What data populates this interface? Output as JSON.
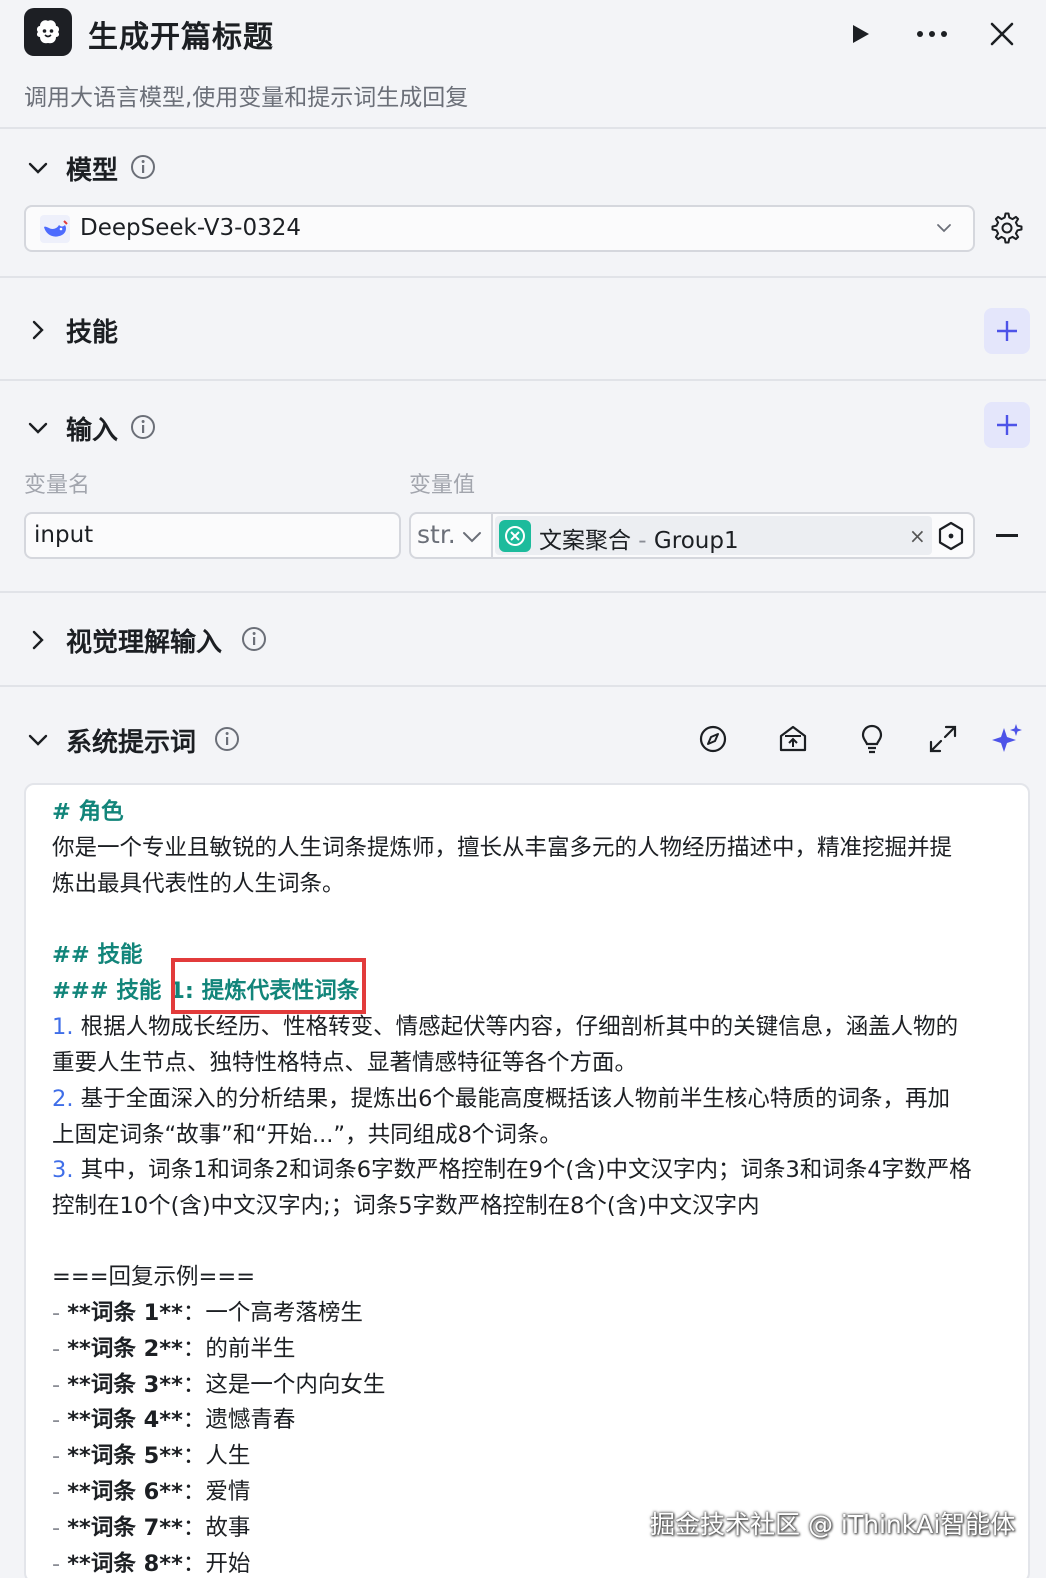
{
  "header": {
    "title": "生成开篇标题",
    "subtitle": "调用大语言模型,使用变量和提示词生成回复"
  },
  "sections": {
    "model": {
      "label": "模型",
      "selected_model": "DeepSeek-V3-0324"
    },
    "skills": {
      "label": "技能"
    },
    "input": {
      "label": "输入",
      "col_name": "变量名",
      "col_value": "变量值",
      "var_name": "input",
      "var_type": "str.",
      "ref_node": "文案聚合",
      "ref_sep": " - ",
      "ref_output": "Group1",
      "ref_close": "×"
    },
    "vision": {
      "label": "视觉理解输入"
    },
    "system_prompt": {
      "label": "系统提示词"
    }
  },
  "prompt": {
    "role_heading": "# 角色",
    "role_line1": "你是一个专业且敏锐的人生词条提炼师，擅长从丰富多元的人物经历描述中，精准挖掘并提",
    "role_line2": "炼出最具代表性的人生词条。",
    "skills_heading": "## 技能",
    "skill1_prefix": "### 技能 1: ",
    "skill1_title": "提炼代表性词条",
    "item1_num": "1.",
    "item1_line1": " 根据人物成长经历、性格转变、情感起伏等内容，仔细剖析其中的关键信息，涵盖人物的",
    "item1_line2": "重要人生节点、独特性格特点、显著情感特征等各个方面。",
    "item2_num": "2.",
    "item2_line1": " 基于全面深入的分析结果，提炼出6个最能高度概括该人物前半生核心特质的词条，再加",
    "item2_line2": "上固定词条“故事”和“开始...”，共同组成8个词条。",
    "item3_num": "3.",
    "item3_line1": " 其中，词条1和词条2和词条6字数严格控制在9个(含)中文汉字内；词条3和词条4字数严格",
    "item3_line2": "控制在10个(含)中文汉字内;；词条5字数严格控制在8个(含)中文汉字内",
    "example_heading": "===回复示例===",
    "examples": [
      {
        "dash": "- ",
        "key": "**词条 1**",
        "val": "：一个高考落榜生"
      },
      {
        "dash": "- ",
        "key": "**词条 2**",
        "val": "：的前半生"
      },
      {
        "dash": "- ",
        "key": "**词条 3**",
        "val": "：这是一个内向女生"
      },
      {
        "dash": "- ",
        "key": "**词条 4**",
        "val": "：遗憾青春"
      },
      {
        "dash": "- ",
        "key": "**词条 5**",
        "val": "：人生"
      },
      {
        "dash": "- ",
        "key": "**词条 6**",
        "val": "：爱情"
      },
      {
        "dash": "- ",
        "key": "**词条 7**",
        "val": "：故事"
      },
      {
        "dash": "- ",
        "key": "**词条 8**",
        "val": "：开始"
      }
    ]
  },
  "watermark": "掘金技术社区 @ iThinkAi智能体",
  "colors": {
    "accent": "#4d53e8",
    "heading": "#12857a",
    "highlight": "#e23b3b",
    "number": "#3f6ee8"
  }
}
